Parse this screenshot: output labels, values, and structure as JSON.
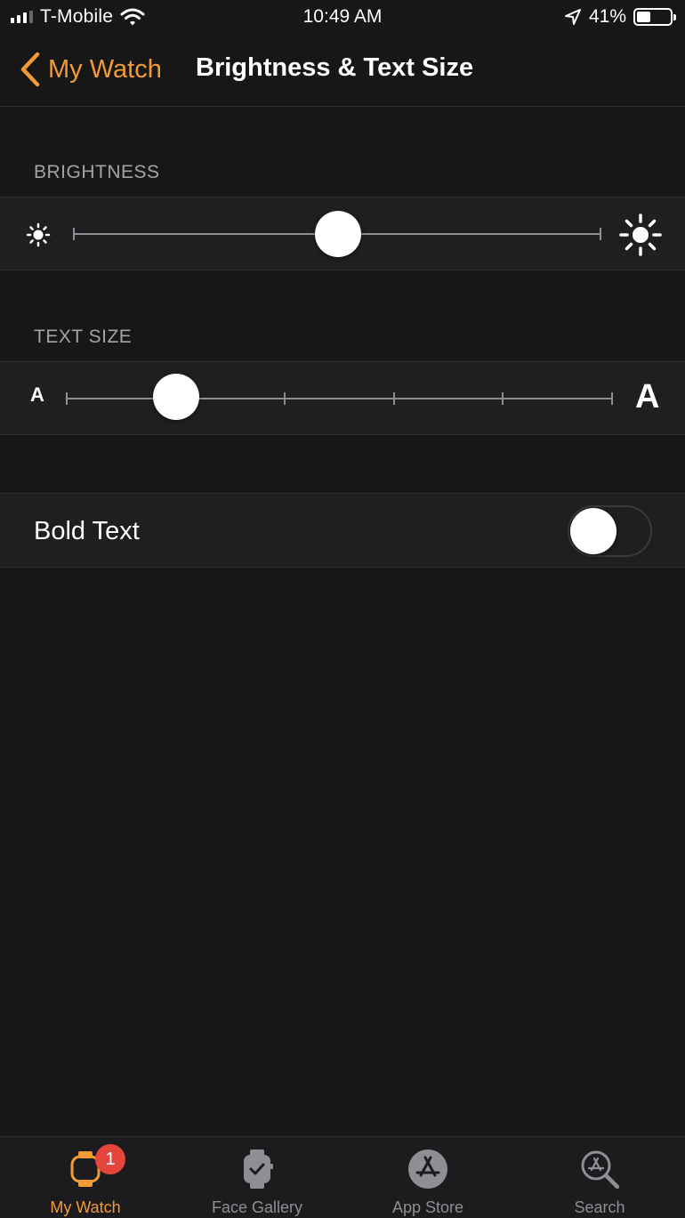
{
  "status_bar": {
    "carrier": "T-Mobile",
    "time": "10:49 AM",
    "battery": "41%"
  },
  "nav": {
    "back_label": "My Watch",
    "title": "Brightness & Text Size"
  },
  "brightness": {
    "header": "BRIGHTNESS",
    "value_fraction": 0.5
  },
  "text_size": {
    "header": "TEXT SIZE",
    "small_label": "A",
    "large_label": "A",
    "steps": 6,
    "selected_step": 1
  },
  "bold_text": {
    "label": "Bold Text",
    "enabled": false
  },
  "tab_bar": {
    "tabs": [
      {
        "label": "My Watch",
        "icon": "watch-icon",
        "active": true,
        "badge": "1"
      },
      {
        "label": "Face Gallery",
        "icon": "face-gallery-icon",
        "active": false
      },
      {
        "label": "App Store",
        "icon": "app-store-icon",
        "active": false
      },
      {
        "label": "Search",
        "icon": "search-icon",
        "active": false
      }
    ]
  },
  "colors": {
    "accent": "#f19a36",
    "background": "#171718",
    "row_background": "#1f1f21",
    "badge": "#e5453b"
  }
}
